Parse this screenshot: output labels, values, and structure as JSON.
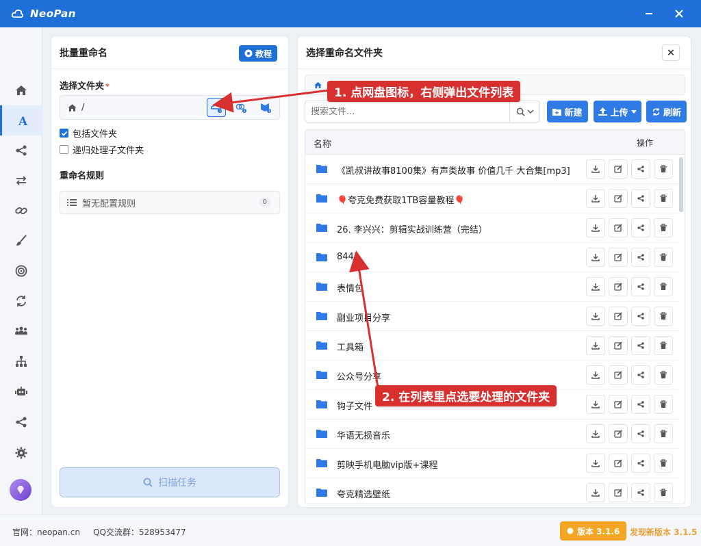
{
  "app": {
    "title": "NeoPan"
  },
  "left_panel": {
    "title": "批量重命名",
    "tutorial_label": "教程",
    "folder_label": "选择文件夹",
    "required_mark": "*",
    "folder_path": "/",
    "include_folders_label": "包括文件夹",
    "include_folders_checked": true,
    "recursive_label": "递归处理子文件夹",
    "recursive_checked": false,
    "rules_title": "重命名规则",
    "rules_empty_text": "暂无配置规则",
    "rules_count": "0",
    "scan_label": "扫描任务"
  },
  "right_panel": {
    "title": "选择重命名文件夹",
    "close_label": "×",
    "search_placeholder": "搜索文件...",
    "new_label": "新建",
    "upload_label": "上传",
    "refresh_label": "刷新",
    "col_name": "名称",
    "col_ops": "操作",
    "files": [
      "《凯叔讲故事8100集》有声类故事 价值几千 大合集[mp3]",
      "🎈夸克免费获取1TB容量教程🎈",
      "26. 李兴兴：剪辑实战训练营（完结）",
      "8441",
      "表情包",
      "副业项目分享",
      "工具箱",
      "公众号分享",
      "钩子文件",
      "华语无损音乐",
      "剪映手机电脑vip版+课程",
      "夸克精选壁纸"
    ]
  },
  "annotations": {
    "step1": "1. 点网盘图标，右侧弹出文件列表",
    "step2": "2. 在列表里点选要处理的文件夹"
  },
  "status": {
    "site": "官网：neopan.cn",
    "qq": "QQ交流群：528953477",
    "version": "版本 3.1.6",
    "new_version": "发现新版本 3.1.5"
  },
  "colors": {
    "brand": "#1f6fd8",
    "annotation": "#d8302f",
    "version_badge": "#f5a623",
    "folder": "#2f7ae5"
  }
}
